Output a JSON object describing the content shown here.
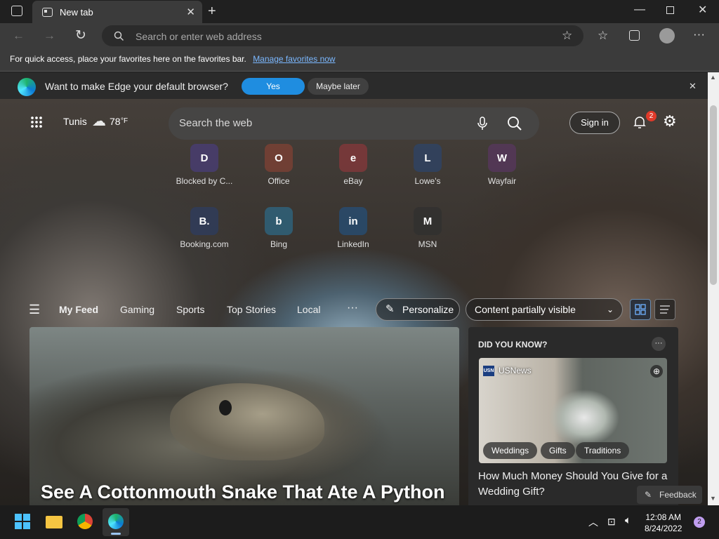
{
  "browser": {
    "tab_title": "New tab",
    "omnibox_placeholder": "Search or enter web address",
    "favbar_text": "For quick access, place your favorites here on the favorites bar.",
    "favbar_link": "Manage favorites now"
  },
  "infobar": {
    "message": "Want to make Edge your default browser?",
    "yes_label": "Yes",
    "later_label": "Maybe later"
  },
  "ntp": {
    "city": "Tunis",
    "temperature": "78",
    "temp_unit": "°F",
    "search_placeholder": "Search the web",
    "signin_label": "Sign in",
    "notification_count": "2",
    "quick_links": [
      {
        "label": "Blocked by C...",
        "glyph": "D",
        "color": "#5b3fc4"
      },
      {
        "label": "Office",
        "glyph": "O",
        "color": "#d6492a"
      },
      {
        "label": "eBay",
        "glyph": "e",
        "color": "#e53238"
      },
      {
        "label": "Lowe's",
        "glyph": "L",
        "color": "#1a4fa0"
      },
      {
        "label": "Wayfair",
        "glyph": "W",
        "color": "#7a2f8a"
      },
      {
        "label": "Booking.com",
        "glyph": "B.",
        "color": "#1c3f8c"
      },
      {
        "label": "Bing",
        "glyph": "b",
        "color": "#1b9fe0"
      },
      {
        "label": "LinkedIn",
        "glyph": "in",
        "color": "#0a66c2"
      },
      {
        "label": "MSN",
        "glyph": "M",
        "color": "#222222"
      }
    ]
  },
  "feed": {
    "tabs": [
      "My Feed",
      "Gaming",
      "Sports",
      "Top Stories",
      "Local"
    ],
    "personalize_label": "Personalize",
    "content_select": "Content partially visible",
    "main_title": "See A Cottonmouth Snake That Ate A Python",
    "side": {
      "header": "DID YOU KNOW?",
      "source": "USNews",
      "tags": [
        "Weddings",
        "Gifts",
        "Traditions"
      ],
      "title": "How Much Money Should You Give for a Wedding Gift?"
    },
    "feedback_label": "Feedback"
  },
  "taskbar": {
    "time": "12:08 AM",
    "date": "8/24/2022",
    "notification_count": "2"
  }
}
